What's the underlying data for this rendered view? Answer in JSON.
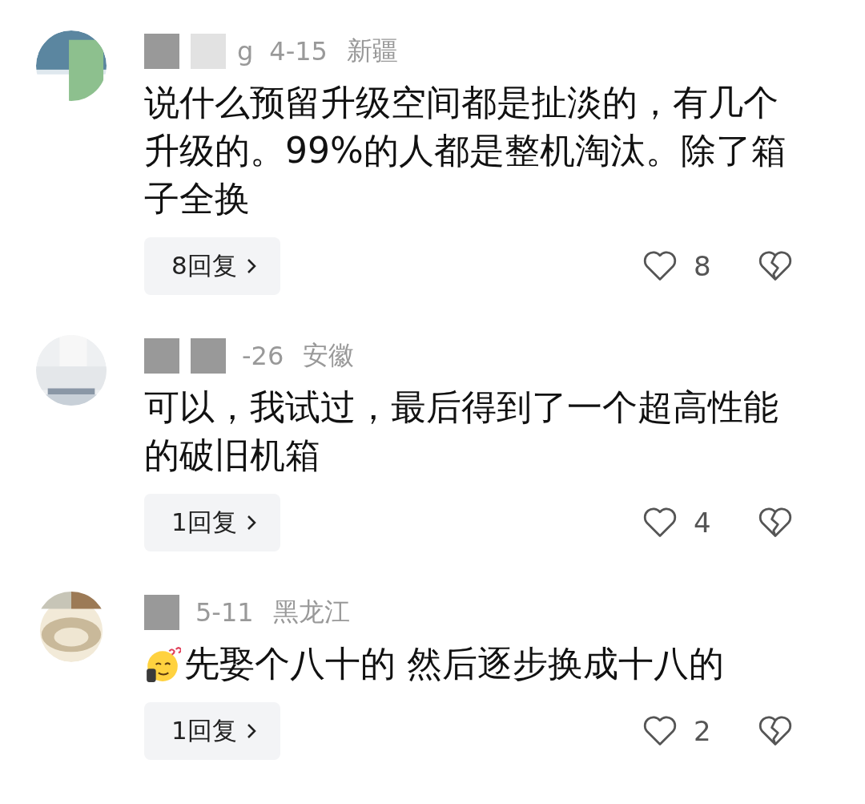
{
  "comments": [
    {
      "name_parts": [
        {
          "kind": "block",
          "color": "#999999"
        },
        {
          "kind": "block",
          "color": "#e2e2e2"
        },
        {
          "kind": "text",
          "text": "g"
        }
      ],
      "date": "4-15",
      "location": "新疆",
      "text": "说什么预留升级空间都是扯淡的，有几个升级的。99%的人都是整机淘汰。除了箱子全换",
      "replies": "8回复",
      "likes": "8"
    },
    {
      "name_parts": [
        {
          "kind": "block",
          "color": "#999999"
        },
        {
          "kind": "block",
          "color": "#999999"
        }
      ],
      "date": "-26",
      "location": "安徽",
      "text": "可以，我试过，最后得到了一个超高性能的破旧机箱",
      "replies": "1回复",
      "likes": "4"
    },
    {
      "name_parts": [
        {
          "kind": "block",
          "color": "#999999"
        }
      ],
      "date": "5-11",
      "location": "黑龙江",
      "emoji": true,
      "text": "先娶个八十的 然后逐步换成十八的",
      "replies": "1回复",
      "likes": "2"
    }
  ]
}
